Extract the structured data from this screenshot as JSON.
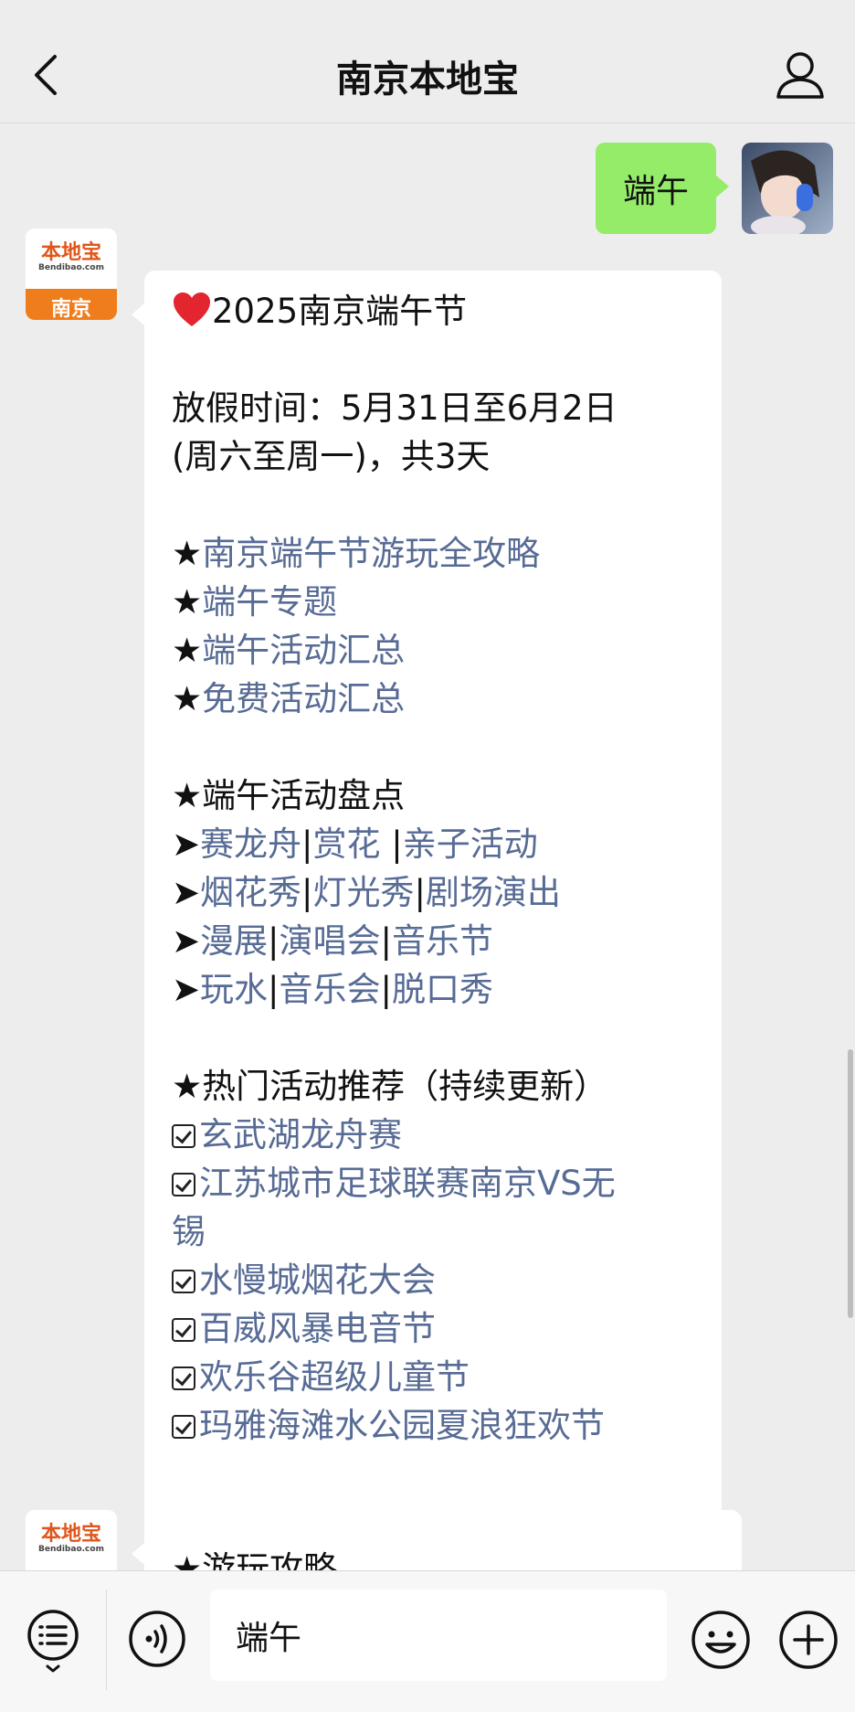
{
  "header": {
    "title": "南京本地宝"
  },
  "user_message": {
    "text": "端午"
  },
  "bot_avatar": {
    "brand": "本地宝",
    "domain": "Bendibao.com",
    "city": "南京"
  },
  "message1": {
    "title": "2025南京端午节",
    "holiday_line1": "放假时间：5月31日至6月2日",
    "holiday_line2": "(周六至周一)，共3天",
    "guides": [
      "南京端午节游玩全攻略",
      "端午专题",
      "端午活动汇总",
      "免费活动汇总"
    ],
    "activities_heading": "端午活动盘点",
    "activity_rows": [
      [
        "赛龙舟",
        "赏花 ",
        "亲子活动"
      ],
      [
        "烟花秀",
        "灯光秀",
        "剧场演出"
      ],
      [
        "漫展",
        "演唱会",
        "音乐节"
      ],
      [
        "玩水",
        "音乐会",
        "脱口秀"
      ]
    ],
    "hot_heading": "热门活动推荐（持续更新）",
    "hot_items": [
      "玄武湖龙舟赛",
      "江苏城市足球联赛南京VS无",
      "锡",
      "水慢城烟花大会",
      "百威风暴电音节",
      "欢乐谷超级儿童节",
      "玛雅海滩水公园夏浪狂欢节"
    ]
  },
  "message2": {
    "title": "游玩攻略"
  },
  "input": {
    "value": "端午"
  },
  "colors": {
    "link": "#576b95",
    "user_bubble": "#95ec69",
    "avatar_orange": "#f07d1c",
    "heart": "#e2252f"
  },
  "icons": [
    "back-arrow-icon",
    "profile-icon",
    "heart-icon",
    "star-icon",
    "arrow-icon",
    "checkbox-icon",
    "menu-icon",
    "voice-icon",
    "emoji-icon",
    "plus-icon"
  ]
}
